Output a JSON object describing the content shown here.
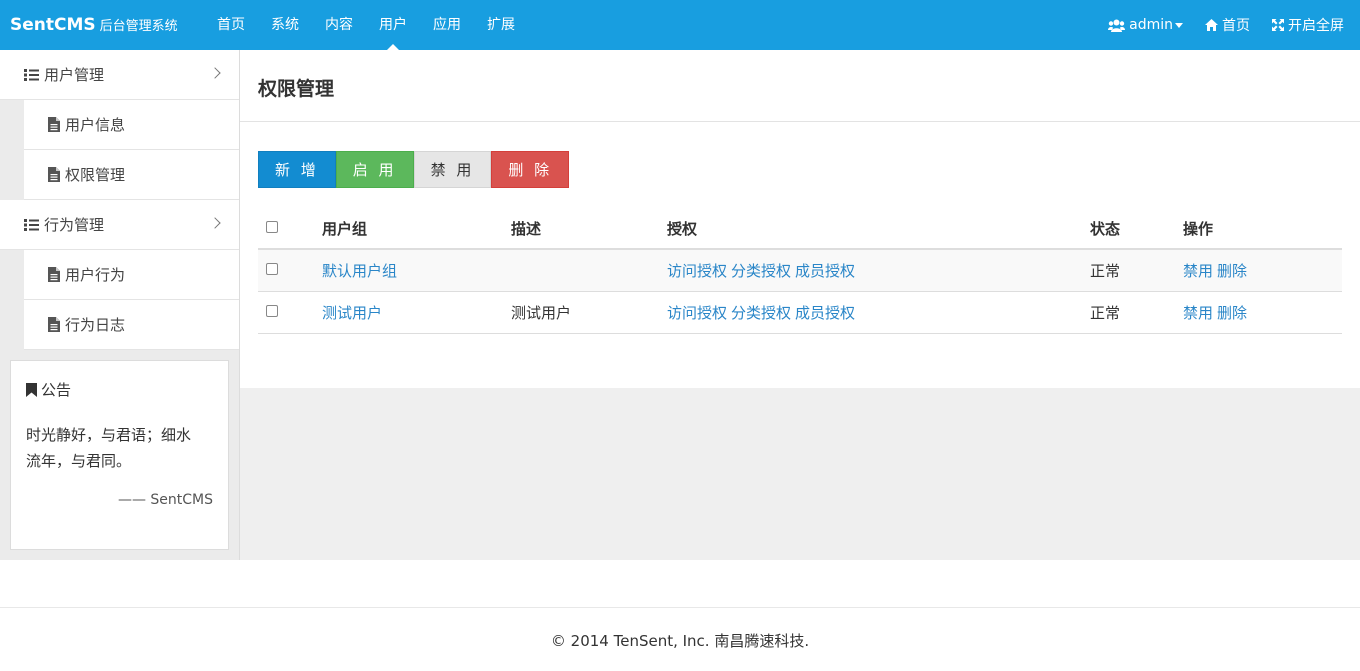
{
  "brand": {
    "name": "SentCMS",
    "subtitle": "后台管理系统"
  },
  "topnav": [
    {
      "label": "首页"
    },
    {
      "label": "系统"
    },
    {
      "label": "内容"
    },
    {
      "label": "用户",
      "active": true
    },
    {
      "label": "应用"
    },
    {
      "label": "扩展"
    }
  ],
  "topright": {
    "user": "admin",
    "home": "首页",
    "fullscreen": "开启全屏"
  },
  "sidebar": {
    "groups": [
      {
        "label": "用户管理",
        "items": [
          {
            "label": "用户信息"
          },
          {
            "label": "权限管理"
          }
        ]
      },
      {
        "label": "行为管理",
        "items": [
          {
            "label": "用户行为"
          },
          {
            "label": "行为日志"
          }
        ]
      }
    ],
    "notice": {
      "title": "公告",
      "body_line1": "时光静好，与君语；细水",
      "body_line2": "流年，与君同。",
      "sign": "—— SentCMS"
    }
  },
  "main": {
    "title": "权限管理",
    "buttons": {
      "add": "新 增",
      "enable": "启 用",
      "disable": "禁 用",
      "delete": "删 除"
    },
    "table": {
      "headers": {
        "group": "用户组",
        "desc": "描述",
        "auth": "授权",
        "status": "状态",
        "ops": "操作"
      },
      "rows": [
        {
          "group": "默认用户组",
          "desc": "",
          "auth": [
            "访问授权",
            "分类授权",
            "成员授权"
          ],
          "status": "正常",
          "ops": [
            "禁用",
            "删除"
          ]
        },
        {
          "group": "测试用户",
          "desc": "测试用户",
          "auth": [
            "访问授权",
            "分类授权",
            "成员授权"
          ],
          "status": "正常",
          "ops": [
            "禁用",
            "删除"
          ]
        }
      ]
    }
  },
  "footer": {
    "text": "© 2014 TenSent, Inc. 南昌腾速科技."
  },
  "colors": {
    "topbar": "#189ee0",
    "link": "#2a86c8",
    "primary": "#138cd1",
    "success": "#5cb85c",
    "danger": "#d9534f"
  }
}
